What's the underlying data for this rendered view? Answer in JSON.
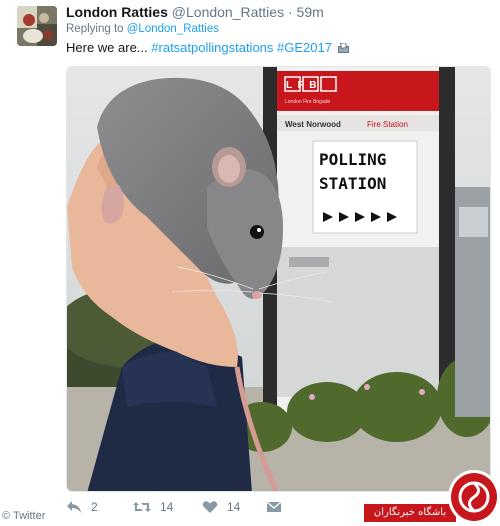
{
  "tweet": {
    "display_name": "London Ratties",
    "handle": "@London_Ratties",
    "separator": "·",
    "time": "59m",
    "replying_prefix": "Replying to",
    "replying_handle": "@London_Ratties",
    "text_plain": "Here we are...",
    "hashtag_1": "#ratsatpollingstations",
    "hashtag_2": "#GE2017",
    "photo": {
      "sign_logo": "LFB",
      "sign_sub": "London Fire Brigade",
      "sign_location": "West Norwood",
      "sign_location_suffix": "Fire Station",
      "poster_line_1": "POLLING",
      "poster_line_2": "STATION"
    },
    "actions": {
      "reply_icon": "reply-icon",
      "reply_count": "2",
      "retweet_icon": "retweet-icon",
      "retweet_count": "14",
      "like_icon": "heart-icon",
      "like_count": "14",
      "dm_icon": "envelope-icon"
    }
  },
  "watermarks": {
    "source_label": "© Twitter",
    "agency_label": "باشگاه خبرنگاران"
  },
  "colors": {
    "link": "#1da1f2",
    "meta": "#657786",
    "text": "#14171a",
    "sign_red": "#c8161d"
  }
}
